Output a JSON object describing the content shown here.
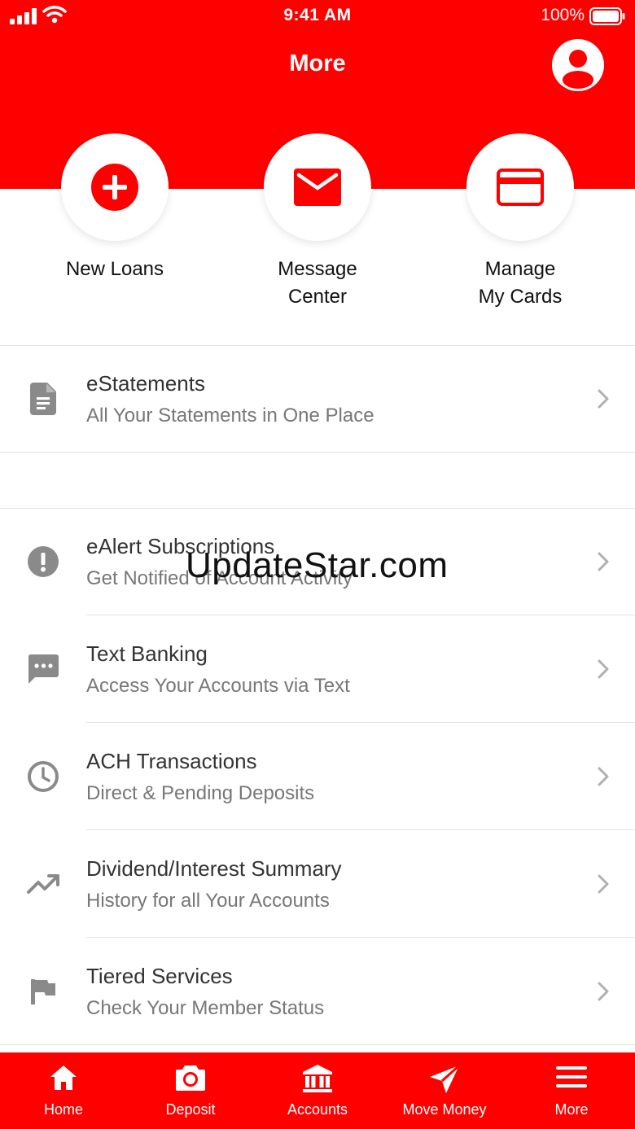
{
  "colors": {
    "brand": "#ff0000",
    "icon_gray": "#8a8a8a",
    "text_dark": "#333333",
    "text_sub": "#777777"
  },
  "status_bar": {
    "time": "9:41 AM",
    "battery": "100%"
  },
  "header": {
    "title": "More",
    "profile_icon": "user-circle-icon"
  },
  "quick_actions": [
    {
      "label": "New Loans",
      "icon": "plus-circle-icon"
    },
    {
      "label": "Message\nCenter",
      "icon": "envelope-icon"
    },
    {
      "label": "Manage\nMy Cards",
      "icon": "credit-card-icon"
    }
  ],
  "menu": [
    {
      "title": "eStatements",
      "subtitle": "All Your Statements in One Place",
      "icon": "document-icon"
    },
    {
      "title": "eAlert Subscriptions",
      "subtitle": "Get Notified of Account Activity",
      "icon": "alert-icon"
    },
    {
      "title": "Text Banking",
      "subtitle": "Access Your Accounts via Text",
      "icon": "chat-icon"
    },
    {
      "title": "ACH Transactions",
      "subtitle": "Direct & Pending Deposits",
      "icon": "clock-icon"
    },
    {
      "title": "Dividend/Interest Summary",
      "subtitle": "History for all Your Accounts",
      "icon": "trending-up-icon"
    },
    {
      "title": "Tiered Services",
      "subtitle": "Check Your Member Status",
      "icon": "flag-icon"
    }
  ],
  "watermark": "UpdateStar.com",
  "tabs": [
    {
      "label": "Home",
      "icon": "home-icon"
    },
    {
      "label": "Deposit",
      "icon": "camera-icon"
    },
    {
      "label": "Accounts",
      "icon": "bank-icon"
    },
    {
      "label": "Move Money",
      "icon": "send-icon"
    },
    {
      "label": "More",
      "icon": "menu-icon",
      "active": true
    }
  ]
}
